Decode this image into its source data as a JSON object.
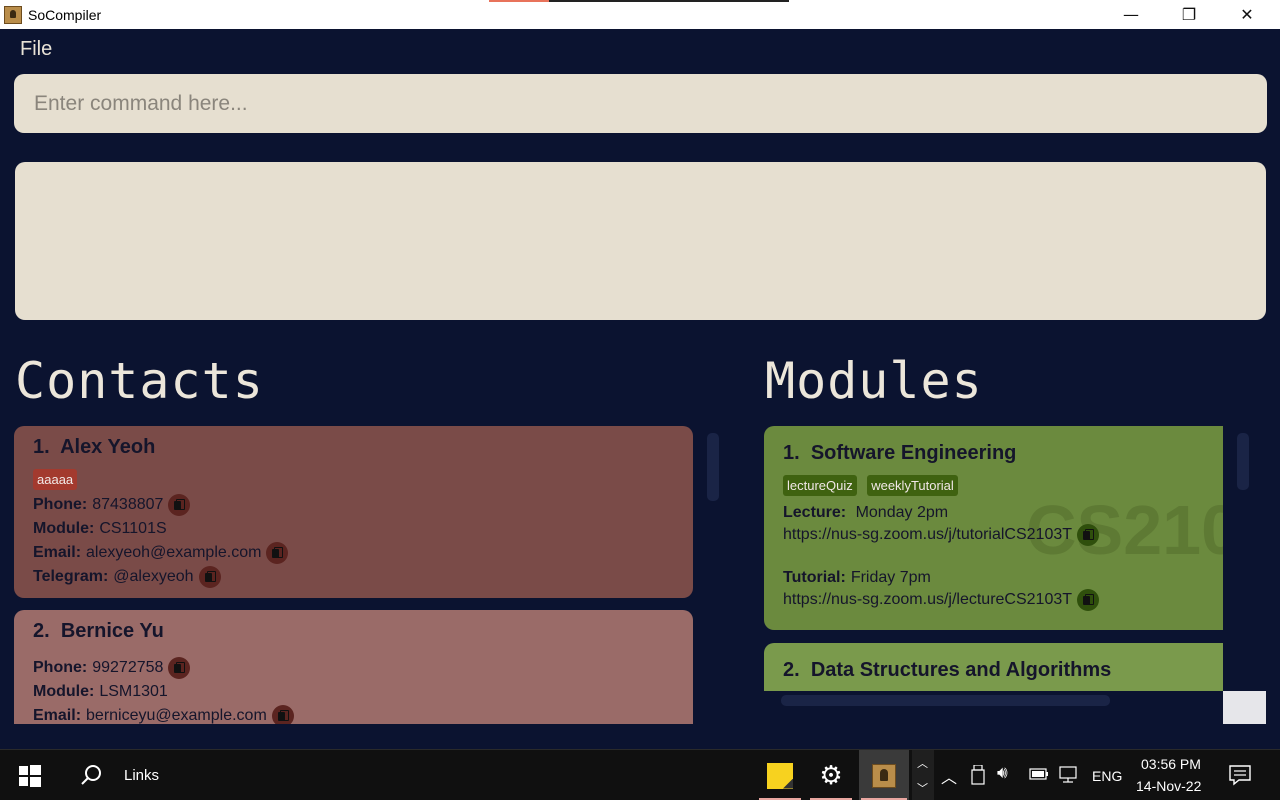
{
  "window": {
    "title": "SoCompiler",
    "minimize": "—",
    "maximize": "❐",
    "close": "✕"
  },
  "menu": {
    "file": "File"
  },
  "command": {
    "placeholder": "Enter command here..."
  },
  "contacts": {
    "heading": "Contacts",
    "items": [
      {
        "index": "1.",
        "name": "Alex Yeoh",
        "tags": [
          "aaaaa"
        ],
        "phone_label": "Phone:",
        "phone": "87438807",
        "module_label": "Module:",
        "module": "CS1101S",
        "email_label": "Email:",
        "email": "alexyeoh@example.com",
        "telegram_label": "Telegram:",
        "telegram": "@alexyeoh"
      },
      {
        "index": "2.",
        "name": "Bernice Yu",
        "phone_label": "Phone:",
        "phone": "99272758",
        "module_label": "Module:",
        "module": "LSM1301",
        "email_label": "Email:",
        "email": "berniceyu@example.com"
      }
    ]
  },
  "modules": {
    "heading": "Modules",
    "items": [
      {
        "index": "1.",
        "name": "Software Engineering",
        "watermark": "CS210",
        "tags": [
          "lectureQuiz",
          "weeklyTutorial"
        ],
        "lecture_label": "Lecture:",
        "lecture_time": "Monday 2pm",
        "lecture_link": "https://nus-sg.zoom.us/j/tutorialCS2103T",
        "tutorial_label": "Tutorial:",
        "tutorial_time": "Friday 7pm",
        "tutorial_link": "https://nus-sg.zoom.us/j/lectureCS2103T"
      },
      {
        "index": "2.",
        "name": "Data Structures and Algorithms"
      }
    ]
  },
  "taskbar": {
    "search_text": "Links",
    "language": "ENG",
    "time": "03:56 PM",
    "date": "14-Nov-22"
  },
  "colors": {
    "background": "#0b1330",
    "contact_card_1": "#7a4b48",
    "contact_card_2": "#9a6b68",
    "module_card_1": "#6b8a3e",
    "module_card_2": "#7a9a4c",
    "input_bg": "#e6dfd0"
  }
}
